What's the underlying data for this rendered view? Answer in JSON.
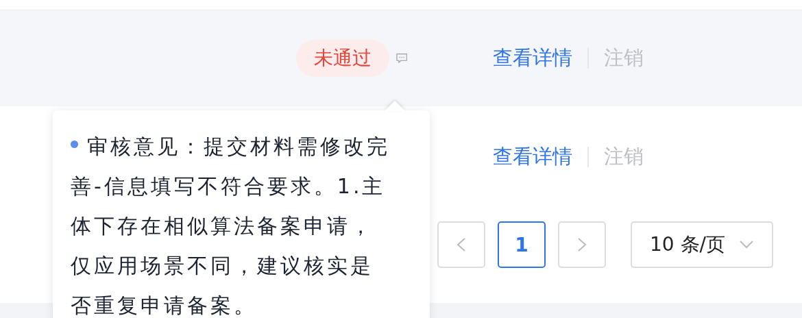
{
  "rows": [
    {
      "status": {
        "label": "未通过",
        "kind": "rejected"
      },
      "comment": true,
      "actions": [
        {
          "label": "查看详情",
          "disabled": false
        },
        {
          "label": "注销",
          "disabled": true
        }
      ]
    },
    {
      "actions": [
        {
          "label": "查看详情",
          "disabled": false
        },
        {
          "label": "注销",
          "disabled": true
        }
      ]
    }
  ],
  "pagination": {
    "prev": {
      "disabled": true
    },
    "pages": [
      {
        "label": "1",
        "selected": true
      }
    ],
    "next": {
      "disabled": true
    },
    "page_size": "10 条/页"
  },
  "popover": {
    "text": "审核意见：提交材料需修改完善-信息填写不符合要求。1.主体下存在相似算法备案申请，仅应用场景不同，建议核实是否重复申请备案。"
  }
}
